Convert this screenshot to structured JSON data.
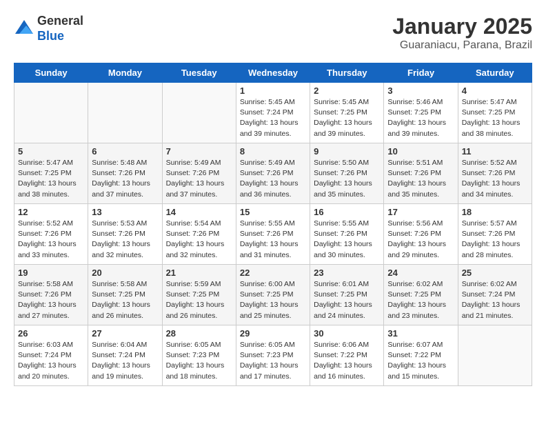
{
  "logo": {
    "general": "General",
    "blue": "Blue"
  },
  "title": "January 2025",
  "location": "Guaraniacu, Parana, Brazil",
  "days_of_week": [
    "Sunday",
    "Monday",
    "Tuesday",
    "Wednesday",
    "Thursday",
    "Friday",
    "Saturday"
  ],
  "weeks": [
    [
      {
        "day": "",
        "info": ""
      },
      {
        "day": "",
        "info": ""
      },
      {
        "day": "",
        "info": ""
      },
      {
        "day": "1",
        "info": "Sunrise: 5:45 AM\nSunset: 7:24 PM\nDaylight: 13 hours\nand 39 minutes."
      },
      {
        "day": "2",
        "info": "Sunrise: 5:45 AM\nSunset: 7:25 PM\nDaylight: 13 hours\nand 39 minutes."
      },
      {
        "day": "3",
        "info": "Sunrise: 5:46 AM\nSunset: 7:25 PM\nDaylight: 13 hours\nand 39 minutes."
      },
      {
        "day": "4",
        "info": "Sunrise: 5:47 AM\nSunset: 7:25 PM\nDaylight: 13 hours\nand 38 minutes."
      }
    ],
    [
      {
        "day": "5",
        "info": "Sunrise: 5:47 AM\nSunset: 7:25 PM\nDaylight: 13 hours\nand 38 minutes."
      },
      {
        "day": "6",
        "info": "Sunrise: 5:48 AM\nSunset: 7:26 PM\nDaylight: 13 hours\nand 37 minutes."
      },
      {
        "day": "7",
        "info": "Sunrise: 5:49 AM\nSunset: 7:26 PM\nDaylight: 13 hours\nand 37 minutes."
      },
      {
        "day": "8",
        "info": "Sunrise: 5:49 AM\nSunset: 7:26 PM\nDaylight: 13 hours\nand 36 minutes."
      },
      {
        "day": "9",
        "info": "Sunrise: 5:50 AM\nSunset: 7:26 PM\nDaylight: 13 hours\nand 35 minutes."
      },
      {
        "day": "10",
        "info": "Sunrise: 5:51 AM\nSunset: 7:26 PM\nDaylight: 13 hours\nand 35 minutes."
      },
      {
        "day": "11",
        "info": "Sunrise: 5:52 AM\nSunset: 7:26 PM\nDaylight: 13 hours\nand 34 minutes."
      }
    ],
    [
      {
        "day": "12",
        "info": "Sunrise: 5:52 AM\nSunset: 7:26 PM\nDaylight: 13 hours\nand 33 minutes."
      },
      {
        "day": "13",
        "info": "Sunrise: 5:53 AM\nSunset: 7:26 PM\nDaylight: 13 hours\nand 32 minutes."
      },
      {
        "day": "14",
        "info": "Sunrise: 5:54 AM\nSunset: 7:26 PM\nDaylight: 13 hours\nand 32 minutes."
      },
      {
        "day": "15",
        "info": "Sunrise: 5:55 AM\nSunset: 7:26 PM\nDaylight: 13 hours\nand 31 minutes."
      },
      {
        "day": "16",
        "info": "Sunrise: 5:55 AM\nSunset: 7:26 PM\nDaylight: 13 hours\nand 30 minutes."
      },
      {
        "day": "17",
        "info": "Sunrise: 5:56 AM\nSunset: 7:26 PM\nDaylight: 13 hours\nand 29 minutes."
      },
      {
        "day": "18",
        "info": "Sunrise: 5:57 AM\nSunset: 7:26 PM\nDaylight: 13 hours\nand 28 minutes."
      }
    ],
    [
      {
        "day": "19",
        "info": "Sunrise: 5:58 AM\nSunset: 7:26 PM\nDaylight: 13 hours\nand 27 minutes."
      },
      {
        "day": "20",
        "info": "Sunrise: 5:58 AM\nSunset: 7:25 PM\nDaylight: 13 hours\nand 26 minutes."
      },
      {
        "day": "21",
        "info": "Sunrise: 5:59 AM\nSunset: 7:25 PM\nDaylight: 13 hours\nand 26 minutes."
      },
      {
        "day": "22",
        "info": "Sunrise: 6:00 AM\nSunset: 7:25 PM\nDaylight: 13 hours\nand 25 minutes."
      },
      {
        "day": "23",
        "info": "Sunrise: 6:01 AM\nSunset: 7:25 PM\nDaylight: 13 hours\nand 24 minutes."
      },
      {
        "day": "24",
        "info": "Sunrise: 6:02 AM\nSunset: 7:25 PM\nDaylight: 13 hours\nand 23 minutes."
      },
      {
        "day": "25",
        "info": "Sunrise: 6:02 AM\nSunset: 7:24 PM\nDaylight: 13 hours\nand 21 minutes."
      }
    ],
    [
      {
        "day": "26",
        "info": "Sunrise: 6:03 AM\nSunset: 7:24 PM\nDaylight: 13 hours\nand 20 minutes."
      },
      {
        "day": "27",
        "info": "Sunrise: 6:04 AM\nSunset: 7:24 PM\nDaylight: 13 hours\nand 19 minutes."
      },
      {
        "day": "28",
        "info": "Sunrise: 6:05 AM\nSunset: 7:23 PM\nDaylight: 13 hours\nand 18 minutes."
      },
      {
        "day": "29",
        "info": "Sunrise: 6:05 AM\nSunset: 7:23 PM\nDaylight: 13 hours\nand 17 minutes."
      },
      {
        "day": "30",
        "info": "Sunrise: 6:06 AM\nSunset: 7:22 PM\nDaylight: 13 hours\nand 16 minutes."
      },
      {
        "day": "31",
        "info": "Sunrise: 6:07 AM\nSunset: 7:22 PM\nDaylight: 13 hours\nand 15 minutes."
      },
      {
        "day": "",
        "info": ""
      }
    ]
  ]
}
